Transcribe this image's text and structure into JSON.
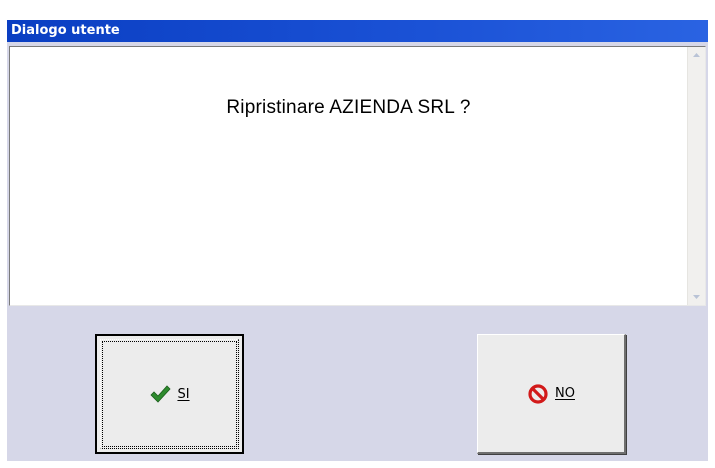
{
  "window": {
    "title": "Dialogo utente"
  },
  "message": {
    "text": "Ripristinare AZIENDA SRL ?"
  },
  "buttons": {
    "yes_label": "SI",
    "yes_icon": "checkmark-icon",
    "no_label": "NO",
    "no_icon": "prohibited-icon"
  },
  "colors": {
    "titlebar": "#0a3ec2",
    "dialog_background": "#d6d7e8",
    "check_green": "#2e8b2e",
    "no_red": "#d21a1a"
  }
}
